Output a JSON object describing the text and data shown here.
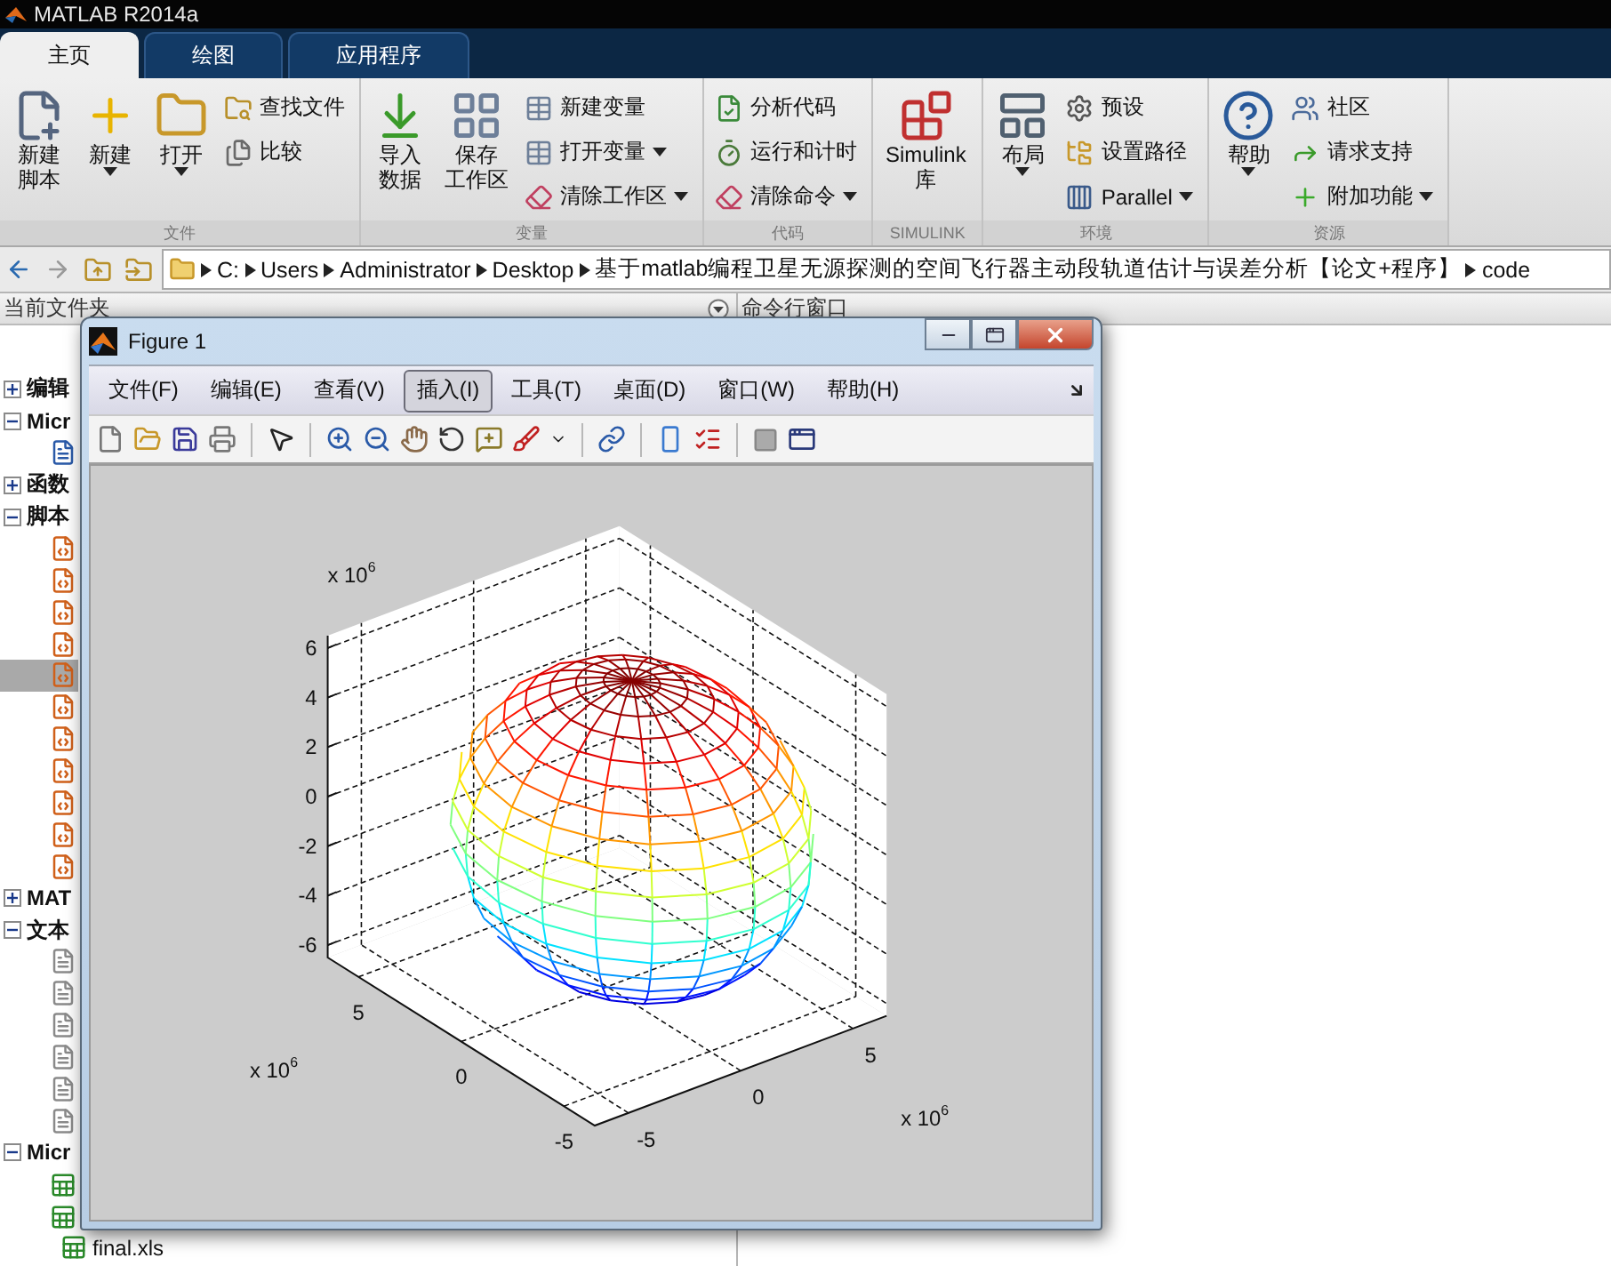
{
  "app": {
    "title": "MATLAB R2014a"
  },
  "ribbon_tabs": [
    {
      "label": "主页",
      "selected": true
    },
    {
      "label": "绘图",
      "selected": false
    },
    {
      "label": "应用程序",
      "selected": false
    }
  ],
  "ribbon_groups": [
    {
      "label": "文件",
      "columns": [
        {
          "kind": "large",
          "lines": [
            "新建",
            "脚本"
          ],
          "dropdown": false
        },
        {
          "kind": "large",
          "lines": [
            "新建"
          ],
          "dropdown": true
        },
        {
          "kind": "large",
          "lines": [
            "打开"
          ],
          "dropdown": true
        },
        {
          "kind": "stack",
          "items": [
            {
              "label": "查找文件",
              "dropdown": false
            },
            {
              "label": "比较",
              "dropdown": false
            }
          ]
        }
      ]
    },
    {
      "label": "变量",
      "columns": [
        {
          "kind": "large",
          "lines": [
            "导入",
            "数据"
          ],
          "dropdown": false
        },
        {
          "kind": "large",
          "lines": [
            "保存",
            "工作区"
          ],
          "dropdown": false
        },
        {
          "kind": "stack",
          "items": [
            {
              "label": "新建变量",
              "dropdown": false
            },
            {
              "label": "打开变量",
              "dropdown": true
            },
            {
              "label": "清除工作区",
              "dropdown": true
            }
          ]
        }
      ]
    },
    {
      "label": "代码",
      "columns": [
        {
          "kind": "stack",
          "items": [
            {
              "label": "分析代码",
              "dropdown": false
            },
            {
              "label": "运行和计时",
              "dropdown": false
            },
            {
              "label": "清除命令",
              "dropdown": true
            }
          ]
        }
      ]
    },
    {
      "label": "SIMULINK",
      "columns": [
        {
          "kind": "large",
          "lines": [
            "Simulink",
            "库"
          ],
          "dropdown": false
        }
      ]
    },
    {
      "label": "环境",
      "columns": [
        {
          "kind": "large",
          "lines": [
            "布局"
          ],
          "dropdown": true
        },
        {
          "kind": "stack",
          "items": [
            {
              "label": "预设",
              "dropdown": false
            },
            {
              "label": "设置路径",
              "dropdown": false
            },
            {
              "label": "Parallel",
              "dropdown": true
            }
          ]
        }
      ]
    },
    {
      "label": "资源",
      "columns": [
        {
          "kind": "large",
          "lines": [
            "帮助"
          ],
          "dropdown": true
        },
        {
          "kind": "stack",
          "items": [
            {
              "label": "社区",
              "dropdown": false
            },
            {
              "label": "请求支持",
              "dropdown": false
            },
            {
              "label": "附加功能",
              "dropdown": true
            }
          ]
        }
      ]
    }
  ],
  "address_bar": {
    "path": [
      "C:",
      "Users",
      "Administrator",
      "Desktop",
      "基于matlab编程卫星无源探测的空间飞行器主动段轨道估计与误差分析【论文+程序】",
      "code"
    ]
  },
  "current_folder": {
    "title": "当前文件夹",
    "tree": [
      {
        "kind": "folder",
        "label": "编辑",
        "expanded": false,
        "selected": false
      },
      {
        "kind": "folder",
        "label": "Micr",
        "expanded": true,
        "selected": false,
        "children": [
          {
            "kind": "word",
            "selected": false
          }
        ]
      },
      {
        "kind": "folder",
        "label": "函数",
        "expanded": false,
        "selected": false
      },
      {
        "kind": "folder",
        "label": "脚本",
        "expanded": true,
        "selected": false,
        "children": [
          {
            "kind": "mfile",
            "selected": false
          },
          {
            "kind": "mfile",
            "selected": false
          },
          {
            "kind": "mfile",
            "selected": false
          },
          {
            "kind": "mfile",
            "selected": false
          },
          {
            "kind": "mfile",
            "selected": true
          },
          {
            "kind": "mfile",
            "selected": false
          },
          {
            "kind": "mfile",
            "selected": false
          },
          {
            "kind": "mfile",
            "selected": false
          },
          {
            "kind": "mfile",
            "selected": false
          },
          {
            "kind": "mfile",
            "selected": false
          },
          {
            "kind": "mfile",
            "selected": false
          }
        ]
      },
      {
        "kind": "folder",
        "label": "MAT",
        "expanded": false,
        "selected": false
      },
      {
        "kind": "folder",
        "label": "文本",
        "expanded": true,
        "selected": false,
        "children": [
          {
            "kind": "text",
            "selected": false
          },
          {
            "kind": "text",
            "selected": false
          },
          {
            "kind": "text",
            "selected": false
          },
          {
            "kind": "text",
            "selected": false
          },
          {
            "kind": "text",
            "selected": false
          },
          {
            "kind": "text",
            "selected": false
          }
        ]
      },
      {
        "kind": "folder",
        "label": "Micr",
        "expanded": true,
        "selected": false,
        "children": [
          {
            "kind": "excel",
            "selected": false
          },
          {
            "kind": "excel",
            "selected": false
          },
          {
            "kind": "excel",
            "label": "final.xls",
            "selected": false
          }
        ]
      }
    ]
  },
  "command_window": {
    "title": "命令行窗口"
  },
  "figure": {
    "title": "Figure 1",
    "menu": [
      {
        "label": "文件(F)",
        "selected": false
      },
      {
        "label": "编辑(E)",
        "selected": false
      },
      {
        "label": "查看(V)",
        "selected": false
      },
      {
        "label": "插入(I)",
        "selected": true
      },
      {
        "label": "工具(T)",
        "selected": false
      },
      {
        "label": "桌面(D)",
        "selected": false
      },
      {
        "label": "窗口(W)",
        "selected": false
      },
      {
        "label": "帮助(H)",
        "selected": false
      }
    ],
    "plot": {
      "z_ticks": [
        "6",
        "4",
        "2",
        "0",
        "-2",
        "-4",
        "-6"
      ],
      "y_ticks": [
        "5",
        "0",
        "-5"
      ],
      "x_ticks": [
        "-5",
        "0",
        "5"
      ],
      "exponents": [
        {
          "base": "x 10",
          "power": "6"
        },
        {
          "base": "x 10",
          "power": "6"
        },
        {
          "base": "x 10",
          "power": "6"
        }
      ]
    }
  }
}
